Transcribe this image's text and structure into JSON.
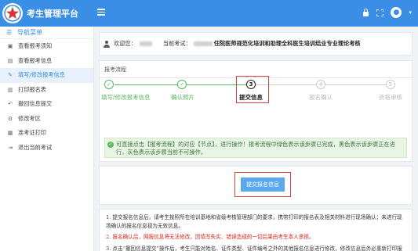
{
  "app": {
    "title": "考生管理平台",
    "menu_icon": "hamburger-icon"
  },
  "header_icons": [
    "lock-icon",
    "fullscreen-icon",
    "avatar-icon"
  ],
  "sidebar": {
    "heading": "导航菜单",
    "items": [
      {
        "label": "查看报考须知",
        "icon": "notice-icon"
      },
      {
        "label": "查看报考信息",
        "icon": "info-icon"
      },
      {
        "label": "填写/修改报考信息",
        "icon": "edit-icon",
        "active": true
      },
      {
        "label": "打印报名表",
        "icon": "print-icon"
      },
      {
        "label": "撤回信息提交",
        "icon": "undo-icon"
      },
      {
        "label": "修改考区",
        "icon": "gear-icon"
      },
      {
        "label": "准考证打印",
        "icon": "ticket-icon"
      },
      {
        "label": "退出当前考试",
        "icon": "exit-icon"
      }
    ]
  },
  "welcome": {
    "greeting": "欢迎您：",
    "exam_label": "当前考试：",
    "exam_name": "住院医师规范化培训和助理全科医生培训结业专业理论考核"
  },
  "process": {
    "title": "报考流程",
    "steps": [
      {
        "label": "填写/修改报考信息",
        "marker": "✓",
        "state": "done"
      },
      {
        "label": "确认照片",
        "marker": "✓",
        "state": "done"
      },
      {
        "label": "提交信息",
        "marker": "3",
        "state": "current"
      },
      {
        "label": "报名确认",
        "marker": "4",
        "state": "todo"
      },
      {
        "label": "资格审核",
        "marker": "5",
        "state": "todo"
      }
    ],
    "tip": "可直接点击【报考流程】的对应【节点】，进行操作！报考流程中绿色表示该步骤已完成，黑色表示该步骤正在进行，灰色表示该步骤当前不可操作。"
  },
  "submit_button": "提交报名信息",
  "notes": {
    "n1": "1. 提交报名信息后，请考生按照所在培训基地和省级考核管理部门的要求，携带打印的报名表及相关材料进行现场确认；未进行现场确认的报名信息视为无效信息。",
    "n2": "2. 报名确认后，网报信息将无法修改，因填写失实、错误造成的一切后果由考生本人承担。",
    "n3": "3. 点击“撤回信息提交”操作后，考生只能对姓名、证件类型、证件编号之外的其他报名信息进行修改，修改信息后务必重新打印报名表，否则将无法进行现场确认。"
  },
  "colors": {
    "header": "#3a8ee6",
    "done": "#5cb85c",
    "highlight": "#e03d3d",
    "notice_red": "#d9221c"
  }
}
